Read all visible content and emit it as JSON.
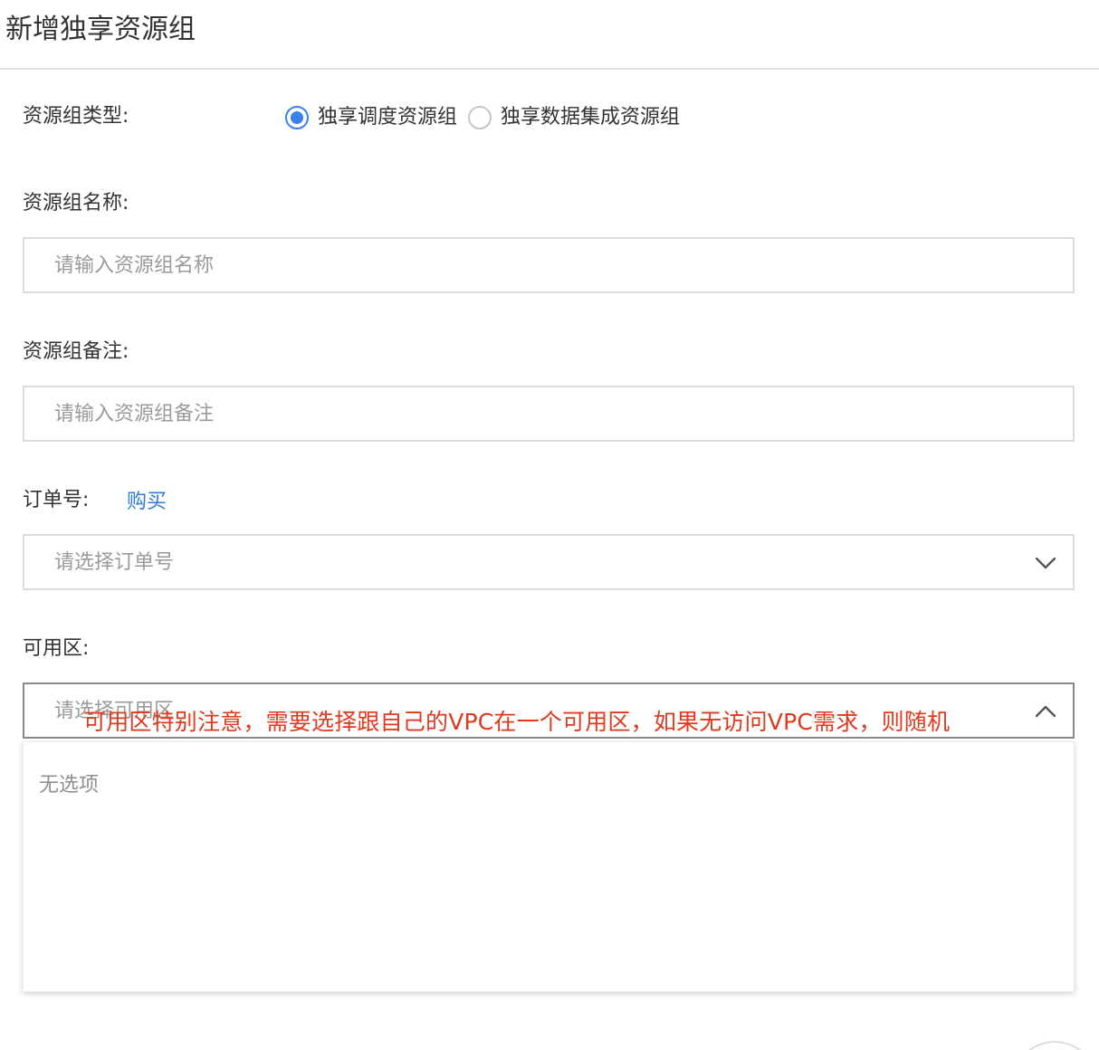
{
  "page": {
    "title": "新增独享资源组"
  },
  "form": {
    "type": {
      "label": "资源组类型:",
      "options": [
        {
          "label": "独享调度资源组",
          "selected": true
        },
        {
          "label": "独享数据集成资源组",
          "selected": false
        }
      ]
    },
    "name": {
      "label": "资源组名称:",
      "placeholder": "请输入资源组名称",
      "value": ""
    },
    "remark": {
      "label": "资源组备注:",
      "placeholder": "请输入资源组备注",
      "value": ""
    },
    "order": {
      "label": "订单号:",
      "buy_link": "购买",
      "placeholder": "请选择订单号",
      "icon": "chevron-down-icon"
    },
    "zone": {
      "label": "可用区:",
      "placeholder": "请选择可用区",
      "icon": "chevron-up-icon",
      "dropdown_empty": "无选项"
    }
  },
  "annotation": {
    "text": "可用区特别注意，需要选择跟自己的VPC在一个可用区，如果无访问VPC需求，则随机",
    "color": "#e0391f"
  },
  "colors": {
    "accent": "#3a82e8",
    "link": "#2f7bd9",
    "border": "#dcdcdc",
    "placeholder": "#9a9a9a"
  }
}
